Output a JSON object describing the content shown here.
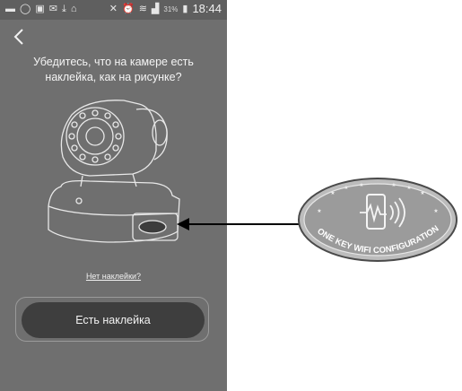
{
  "status_bar": {
    "time": "18:44",
    "battery": "31%",
    "icons": [
      "message-icon",
      "whatsapp-icon",
      "gallery-icon",
      "email-icon",
      "download-icon",
      "inbox-icon",
      "mute-icon",
      "alarm-icon",
      "wifi-icon",
      "signal-icon",
      "battery-icon"
    ]
  },
  "header": {
    "back_icon": "chevron-left-icon"
  },
  "prompt": {
    "line1": "Убедитесь, что на камере есть",
    "line2": "наклейка, как на рисунке?"
  },
  "no_sticker_link": "Нет наклейки?",
  "primary_button": "Есть наклейка",
  "badge": {
    "text": "ONE KEY WIFI CONFIGURATION"
  },
  "colors": {
    "screen_bg": "#6f6f6f",
    "button_bg": "#3e3e3e",
    "text": "#f4f4f4"
  }
}
